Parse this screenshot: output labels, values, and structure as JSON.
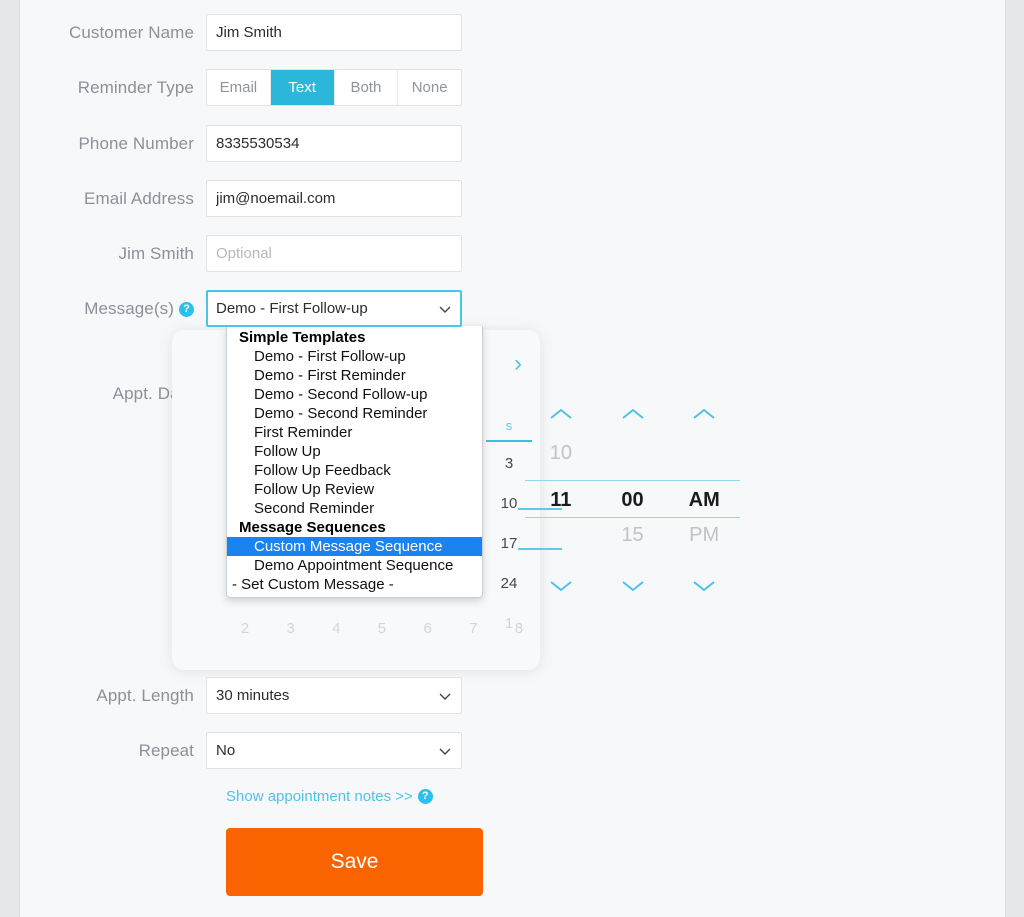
{
  "theme": {
    "accent_teal": "#2ab7da",
    "accent_cyan": "#4ec3e8",
    "save_orange": "#fa6400",
    "highlight_blue": "#1a83f0",
    "page_bg": "#e4e8ea",
    "panel_bg": "#f7f8fa"
  },
  "form": {
    "rows": [
      {
        "label": "Customer Name",
        "value": "Jim Smith",
        "placeholder": ""
      },
      {
        "label": "Reminder Type"
      },
      {
        "label": "Phone Number",
        "value": "8335530534",
        "placeholder": ""
      },
      {
        "label": "Email Address",
        "value": "jim@noemail.com",
        "placeholder": ""
      },
      {
        "label": "Jim Smith",
        "value": "",
        "placeholder": "Optional"
      },
      {
        "label": "Message(s)"
      },
      {
        "label": "Appt. Date"
      },
      {
        "label": "Appt. Length",
        "value": "30 minutes"
      },
      {
        "label": "Repeat",
        "value": "No"
      }
    ],
    "reminder_type": {
      "options": [
        "Email",
        "Text",
        "Both",
        "None"
      ],
      "selected": "Text"
    },
    "messages_select": {
      "value": "Demo - First Follow-up",
      "expanded": true,
      "groups": [
        {
          "label": "Simple Templates",
          "items": [
            "Demo - First Follow-up",
            "Demo - First Reminder",
            "Demo - Second Follow-up",
            "Demo - Second Reminder",
            "First Reminder",
            "Follow Up",
            "Follow Up Feedback",
            "Follow Up Review",
            "Second Reminder"
          ]
        },
        {
          "label": "Message Sequences",
          "items": [
            "Custom Message Sequence",
            "Demo Appointment Sequence"
          ]
        }
      ],
      "plain_option": "- Set Custom Message -",
      "highlighted": "Custom Message Sequence"
    },
    "appt_length": {
      "value": "30 minutes"
    },
    "repeat": {
      "value": "No"
    },
    "notes_link": "Show appointment notes >>",
    "save_label": "Save"
  },
  "calendar": {
    "next_arrow": "›",
    "visible_dow": "s",
    "visible_days": [
      "3",
      "10",
      "17",
      "24"
    ],
    "muted_day": "1",
    "bottom_row": [
      "2",
      "3",
      "4",
      "5",
      "6",
      "7",
      "8"
    ]
  },
  "timepicker": {
    "hour": {
      "above": "10",
      "current": "11",
      "below": ""
    },
    "minute": {
      "above": "",
      "current": "00",
      "below": "15"
    },
    "meridiem": {
      "above": "",
      "current": "AM",
      "below": "PM"
    }
  }
}
